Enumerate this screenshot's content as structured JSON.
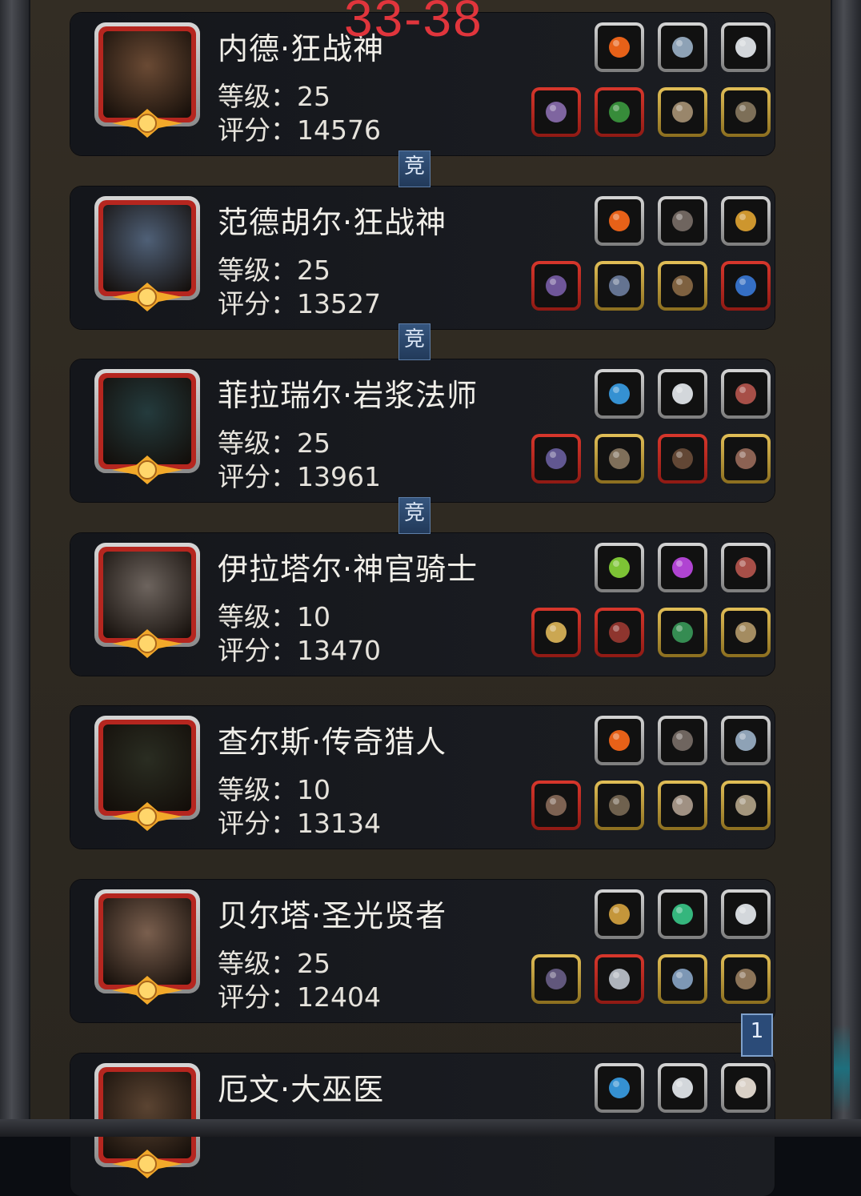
{
  "watermark": "33-38",
  "level_label": "等级",
  "score_label": "评分",
  "separator": "：",
  "connector_label": "竞",
  "page_badge": "1",
  "heroes": [
    {
      "name": "内德·狂战神",
      "level": "25",
      "score": "14576",
      "portrait": "#6a4a34",
      "top_slots": [
        {
          "icon": "fire-orb-icon",
          "frame": "gray"
        },
        {
          "icon": "crystal-emblem-icon",
          "frame": "gray"
        },
        {
          "icon": "white-feather-icon",
          "frame": "gray"
        }
      ],
      "bottom_slots": [
        {
          "icon": "battle-axe-icon",
          "frame": "red"
        },
        {
          "icon": "green-armor-icon",
          "frame": "red"
        },
        {
          "icon": "ring-icon",
          "frame": "gold"
        },
        {
          "icon": "skull-amulet-icon",
          "frame": "gold"
        }
      ]
    },
    {
      "name": "范德胡尔·狂战神",
      "level": "25",
      "score": "13527",
      "portrait": "#4f6077",
      "top_slots": [
        {
          "icon": "fire-orb-icon",
          "frame": "gray"
        },
        {
          "icon": "dark-feather-icon",
          "frame": "gray"
        },
        {
          "icon": "gold-crest-icon",
          "frame": "gray"
        }
      ],
      "bottom_slots": [
        {
          "icon": "double-axe-icon",
          "frame": "red"
        },
        {
          "icon": "plate-armor-icon",
          "frame": "gold"
        },
        {
          "icon": "bronze-amulet-icon",
          "frame": "gold"
        },
        {
          "icon": "blue-bracer-icon",
          "frame": "red"
        }
      ]
    },
    {
      "name": "菲拉瑞尔·岩浆法师",
      "level": "25",
      "score": "13961",
      "portrait": "#243b3d",
      "top_slots": [
        {
          "icon": "blue-orb-icon",
          "frame": "gray"
        },
        {
          "icon": "white-feather-icon",
          "frame": "gray"
        },
        {
          "icon": "red-shell-icon",
          "frame": "gray"
        }
      ],
      "bottom_slots": [
        {
          "icon": "staff-icon",
          "frame": "red"
        },
        {
          "icon": "robe-icon",
          "frame": "gold"
        },
        {
          "icon": "tome-icon",
          "frame": "red"
        },
        {
          "icon": "orb-trinket-icon",
          "frame": "gold"
        }
      ]
    },
    {
      "name": "伊拉塔尔·神官骑士",
      "level": "10",
      "score": "13470",
      "portrait": "#6d645e",
      "top_slots": [
        {
          "icon": "green-crystal-icon",
          "frame": "gray"
        },
        {
          "icon": "purple-gem-icon",
          "frame": "gray"
        },
        {
          "icon": "red-shell-icon",
          "frame": "gray"
        }
      ],
      "bottom_slots": [
        {
          "icon": "hammer-icon",
          "frame": "red"
        },
        {
          "icon": "red-armor-icon",
          "frame": "red"
        },
        {
          "icon": "green-necklace-icon",
          "frame": "gold"
        },
        {
          "icon": "shield-icon",
          "frame": "gold"
        }
      ]
    },
    {
      "name": "查尔斯·传奇猎人",
      "level": "10",
      "score": "13134",
      "portrait": "#2a2d22",
      "top_slots": [
        {
          "icon": "fire-orb-icon",
          "frame": "gray"
        },
        {
          "icon": "dark-feather-icon",
          "frame": "gray"
        },
        {
          "icon": "crystal-emblem-icon",
          "frame": "gray"
        }
      ],
      "bottom_slots": [
        {
          "icon": "crossbow-icon",
          "frame": "red"
        },
        {
          "icon": "leather-armor-icon",
          "frame": "gold"
        },
        {
          "icon": "skull-ring-icon",
          "frame": "gold"
        },
        {
          "icon": "bone-bracer-icon",
          "frame": "gold"
        }
      ]
    },
    {
      "name": "贝尔塔·圣光贤者",
      "level": "25",
      "score": "12404",
      "portrait": "#7a5f4e",
      "top_slots": [
        {
          "icon": "gold-mask-icon",
          "frame": "gray"
        },
        {
          "icon": "green-stone-icon",
          "frame": "gray"
        },
        {
          "icon": "white-feather-icon",
          "frame": "gray"
        }
      ],
      "bottom_slots": [
        {
          "icon": "mace-icon",
          "frame": "gold"
        },
        {
          "icon": "silver-armor-icon",
          "frame": "red"
        },
        {
          "icon": "cross-amulet-icon",
          "frame": "gold"
        },
        {
          "icon": "helmet-icon",
          "frame": "gold"
        }
      ]
    },
    {
      "name": "厄文·大巫医",
      "level": "",
      "score": "",
      "portrait": "#5b4432",
      "top_slots": [
        {
          "icon": "blue-orb-icon",
          "frame": "gray"
        },
        {
          "icon": "white-feather-icon",
          "frame": "gray"
        },
        {
          "icon": "claw-icon",
          "frame": "gray"
        }
      ],
      "bottom_slots": []
    }
  ],
  "icon_colors": {
    "fire-orb-icon": "#ff6a1a",
    "crystal-emblem-icon": "#9cb3c9",
    "white-feather-icon": "#e9edf2",
    "battle-axe-icon": "#8c6fb0",
    "green-armor-icon": "#3c9a3f",
    "ring-icon": "#a89476",
    "skull-amulet-icon": "#8a7a60",
    "dark-feather-icon": "#7a6f68",
    "gold-crest-icon": "#e2a532",
    "double-axe-icon": "#7a5ea8",
    "plate-armor-icon": "#6e7ea0",
    "bronze-amulet-icon": "#8b6a46",
    "blue-bracer-icon": "#3a7ad8",
    "blue-orb-icon": "#3aa0e8",
    "red-shell-icon": "#b8564f",
    "staff-icon": "#6a5fa0",
    "robe-icon": "#8c7a63",
    "tome-icon": "#6b4e3a",
    "orb-trinket-icon": "#9a6b5b",
    "green-crystal-icon": "#8ad83a",
    "purple-gem-icon": "#c24ae8",
    "hammer-icon": "#e0b85a",
    "red-armor-icon": "#9c3a32",
    "green-necklace-icon": "#3a9a5a",
    "shield-icon": "#b59a6a",
    "crossbow-icon": "#8a6b5a",
    "leather-armor-icon": "#7a6a55",
    "skull-ring-icon": "#b0a090",
    "bone-bracer-icon": "#b5a58a",
    "gold-mask-icon": "#d8a540",
    "green-stone-icon": "#3ac98a",
    "mace-icon": "#6a5f88",
    "silver-armor-icon": "#c0c6cf",
    "cross-amulet-icon": "#8aa6c8",
    "helmet-icon": "#9a8060",
    "claw-icon": "#efe6da"
  }
}
